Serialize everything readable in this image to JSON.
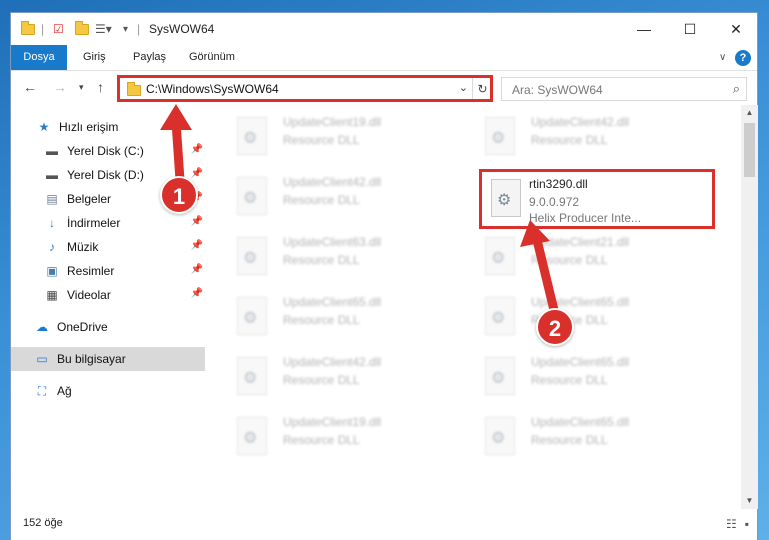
{
  "window": {
    "title": "SysWOW64"
  },
  "ribbon": {
    "tabs": [
      "Dosya",
      "Giriş",
      "Paylaş",
      "Görünüm"
    ],
    "help": "?"
  },
  "address": {
    "path": "C:\\Windows\\SysWOW64",
    "refresh_glyph": "↻"
  },
  "search": {
    "placeholder": "Ara: SysWOW64"
  },
  "sidebar": {
    "items": [
      {
        "label": "Hızlı erişim",
        "icon": "star-icon"
      },
      {
        "label": "Yerel Disk (C:)",
        "icon": "drive-icon",
        "pinned": true
      },
      {
        "label": "Yerel Disk (D:)",
        "icon": "drive-icon",
        "pinned": true
      },
      {
        "label": "Belgeler",
        "icon": "documents-icon",
        "pinned": true
      },
      {
        "label": "İndirmeler",
        "icon": "download-icon",
        "pinned": true
      },
      {
        "label": "Müzik",
        "icon": "music-icon",
        "pinned": true
      },
      {
        "label": "Resimler",
        "icon": "pictures-icon",
        "pinned": true
      },
      {
        "label": "Videolar",
        "icon": "video-icon",
        "pinned": true
      },
      {
        "label": "OneDrive",
        "icon": "cloud-icon"
      },
      {
        "label": "Bu bilgisayar",
        "icon": "computer-icon",
        "selected": true
      },
      {
        "label": "Ağ",
        "icon": "network-icon"
      }
    ]
  },
  "files": [
    {
      "name": "UpdateClient19.dll",
      "desc": "Resource DLL"
    },
    {
      "name": "UpdateClient42.dll",
      "desc": "Resource DLL"
    },
    {
      "name": "UpdateClient42.dll",
      "desc": "Resource DLL"
    },
    {
      "name": "rtin3290.dll",
      "version": "9.0.0.972",
      "desc": "Helix Producer Inte...",
      "highlighted": true
    },
    {
      "name": "UpdateClient63.dll",
      "desc": "Resource DLL"
    },
    {
      "name": "UpdateClient21.dll",
      "desc": "Resource DLL"
    },
    {
      "name": "UpdateClient65.dll",
      "desc": "Resource DLL"
    },
    {
      "name": "UpdateClient65.dll",
      "desc": "Resource DLL"
    },
    {
      "name": "UpdateClient42.dll",
      "desc": "Resource DLL"
    },
    {
      "name": "UpdateClient65.dll",
      "desc": "Resource DLL"
    },
    {
      "name": "UpdateClient19.dll",
      "desc": "Resource DLL"
    },
    {
      "name": "UpdateClient65.dll",
      "desc": "Resource DLL"
    }
  ],
  "status": {
    "count": "152 öğe"
  },
  "markers": [
    "1",
    "2"
  ],
  "colors": {
    "accent": "#1979ca",
    "highlight": "#d9302c"
  }
}
